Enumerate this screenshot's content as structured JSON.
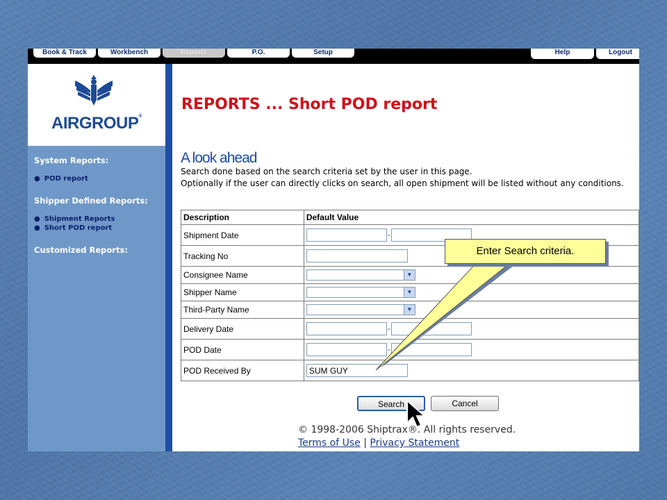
{
  "nav": {
    "tabs": [
      "Book & Track",
      "Workbench",
      "Reports",
      "P.O.",
      "Setup"
    ],
    "active_tab": "Reports",
    "right_tabs": [
      "Help",
      "Logout"
    ]
  },
  "logo": {
    "name": "AIRGROUP",
    "mark": "®"
  },
  "sidebar": {
    "system_reports": {
      "heading": "System Reports:",
      "items": [
        "POD report"
      ]
    },
    "shipper_reports": {
      "heading": "Shipper Defined Reports:",
      "items": [
        "Shipment Reports",
        "Short POD report"
      ]
    },
    "customized_reports": {
      "heading": "Customized Reports:"
    }
  },
  "main": {
    "title": "REPORTS ... Short POD report",
    "subtitle": "A look ahead",
    "description_1": "Search done based on the search criteria set by the user in this page.",
    "description_2": "Optionally if the user can directly clicks on search, all open shipment will be listed without any conditions."
  },
  "form": {
    "headers": [
      "Description",
      "Default Value"
    ],
    "rows": [
      {
        "label": "Shipment Date",
        "type": "daterange"
      },
      {
        "label": "Tracking No",
        "type": "text"
      },
      {
        "label": "Consignee Name",
        "type": "select"
      },
      {
        "label": "Shipper Name",
        "type": "select"
      },
      {
        "label": "Third-Party Name",
        "type": "select"
      },
      {
        "label": "Delivery Date",
        "type": "daterange"
      },
      {
        "label": "POD Date",
        "type": "daterange"
      },
      {
        "label": "POD Received By",
        "type": "text",
        "value": "SUM GUY"
      }
    ],
    "range_separator": "-",
    "search_label": "Search",
    "cancel_label": "Cancel"
  },
  "footer": {
    "copyright": "© 1998-2006 Shiptrax®. All rights reserved.",
    "terms_label": "Terms of Use",
    "separator": "|",
    "privacy_label": "Privacy Statement"
  },
  "callout": {
    "text": "Enter Search criteria."
  },
  "colors": {
    "slide_bg": "#5a82b4",
    "sidebar_bg": "#6f98c8",
    "sidebar_divider": "#1f4fa0",
    "title_red": "#d0101a",
    "subtitle_blue": "#1d4aa6",
    "callout_yellow": "#ffff99"
  },
  "icons": [
    "eagle-logo-icon",
    "dropdown-arrow-icon",
    "mouse-cursor-icon"
  ]
}
